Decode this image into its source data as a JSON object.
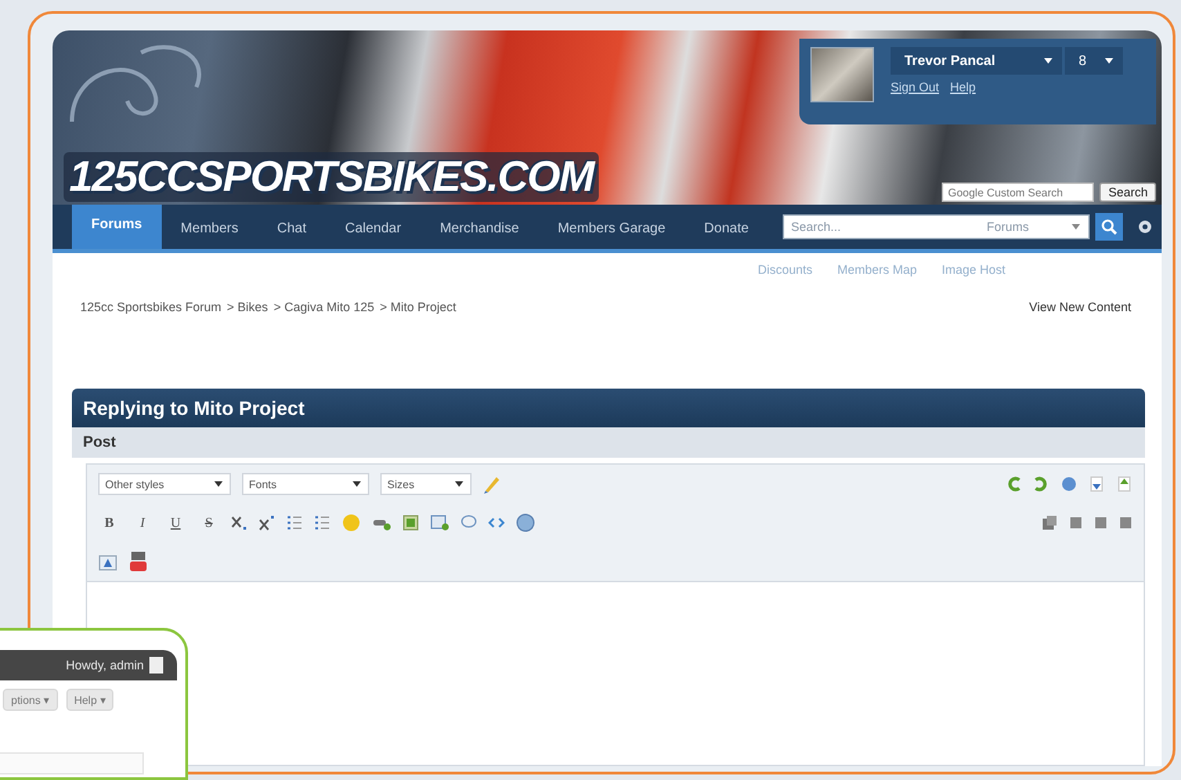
{
  "header": {
    "logo": "125CCSPORTSBIKES.COM",
    "user_panel": {
      "username": "Trevor Pancal",
      "count": "8",
      "links": [
        "Sign Out",
        "Help"
      ]
    },
    "site_search": {
      "placeholder": "Google Custom Search",
      "button": "Search"
    }
  },
  "nav": {
    "tabs": [
      {
        "label": "Forums",
        "selected": true
      },
      {
        "label": "Members",
        "selected": false
      },
      {
        "label": "Chat",
        "selected": false
      },
      {
        "label": "Calendar",
        "selected": false
      },
      {
        "label": "Merchandise",
        "selected": false
      },
      {
        "label": "Members Garage",
        "selected": false
      },
      {
        "label": "Donate",
        "selected": false
      }
    ],
    "search": {
      "placeholder": "Search...",
      "scope": "Forums"
    }
  },
  "sub_links": [
    "Discounts",
    "Members Map",
    "Image Host"
  ],
  "breadcrumb": [
    "125cc Sportsbikes Forum",
    "> Bikes",
    "> Cagiva Mito 125",
    "> Mito Project"
  ],
  "view_new_content": "View New Content",
  "panel": {
    "title": "Replying to Mito Project",
    "section": "Post"
  },
  "editor": {
    "dropdowns": [
      "Other styles",
      "Fonts",
      "Sizes"
    ],
    "format_buttons": [
      "B",
      "I",
      "U",
      "S"
    ]
  },
  "admin_bar": {
    "greeting": "Howdy, admin",
    "menus": [
      "ptions ▾",
      "Help ▾"
    ]
  }
}
